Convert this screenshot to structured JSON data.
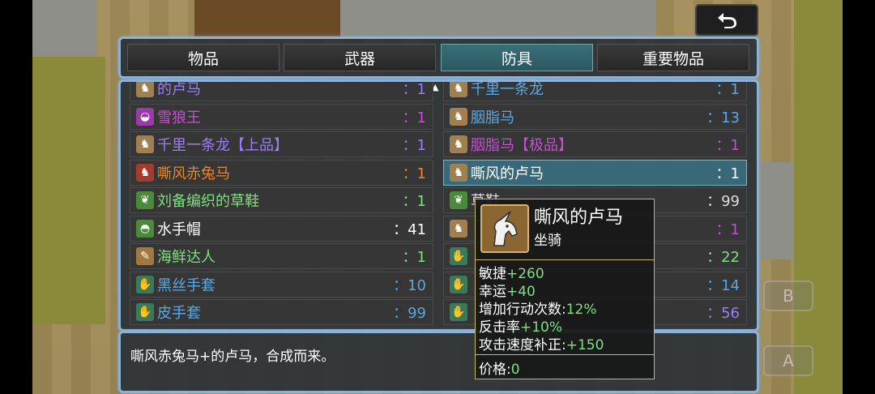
{
  "tabs": [
    "物品",
    "武器",
    "防具",
    "重要物品"
  ],
  "left_items": [
    {
      "name": "的卢马",
      "qty": "：1",
      "color": "#9c7df0",
      "icon": "horse-icon"
    },
    {
      "name": "雪狼王",
      "qty": "：1",
      "color": "#c24fd0",
      "icon": "wolf-icon"
    },
    {
      "name": "千里一条龙【上品】",
      "qty": "：1",
      "color": "#9c7df0",
      "icon": "horse-icon"
    },
    {
      "name": "嘶风赤兔马",
      "qty": "：1",
      "color": "#e8862a",
      "icon": "red-horse-icon"
    },
    {
      "name": "刘备编织的草鞋",
      "qty": "：1",
      "color": "#7ee07e",
      "icon": "sandals-icon"
    },
    {
      "name": "水手帽",
      "qty": "：41",
      "color": "#ffffff",
      "icon": "hat-icon"
    },
    {
      "name": "海鲜达人",
      "qty": "：1",
      "color": "#7ee07e",
      "icon": "fish-icon"
    },
    {
      "name": "黑丝手套",
      "qty": "：10",
      "color": "#5aa8e0",
      "icon": "glove-icon"
    },
    {
      "name": "皮手套",
      "qty": "：99",
      "color": "#5aa8e0",
      "icon": "glove-icon"
    }
  ],
  "right_items": [
    {
      "name": "千里一条龙",
      "qty": "：1",
      "color": "#5aa8e0",
      "icon": "horse-icon"
    },
    {
      "name": "胭脂马",
      "qty": "：13",
      "color": "#5aa8e0",
      "icon": "horse-icon"
    },
    {
      "name": "胭脂马【极品】",
      "qty": "：1",
      "color": "#c24fd0",
      "icon": "horse-icon"
    },
    {
      "name": "嘶风的卢马",
      "qty": "：1",
      "color": "#ffffff",
      "icon": "horse-icon"
    },
    {
      "name": "草鞋",
      "qty": "：99",
      "color": "#dddddd",
      "icon": "sandals-icon"
    },
    {
      "name": "",
      "qty": "：1",
      "color": "#c24fd0",
      "icon": "horse-icon"
    },
    {
      "name": "",
      "qty": "：22",
      "color": "#7ee07e",
      "icon": "glove-icon"
    },
    {
      "name": "",
      "qty": "：14",
      "color": "#5aa8e0",
      "icon": "glove-icon"
    },
    {
      "name": "",
      "qty": "：56",
      "color": "#9c7df0",
      "icon": "glove-icon"
    }
  ],
  "description": "嘶风赤兔马+的卢马，合成而来。",
  "tooltip": {
    "name": "嘶风的卢马",
    "type": "坐骑",
    "stats": [
      {
        "k": "敏捷",
        "v": "+260"
      },
      {
        "k": "幸运",
        "v": "+40"
      },
      {
        "k": "增加行动次数:",
        "v": "12%"
      },
      {
        "k": "反击率",
        "v": "+10%"
      },
      {
        "k": "攻击速度补正:",
        "v": "+150"
      }
    ],
    "price_label": "价格:",
    "price_value": "0"
  },
  "buttons": {
    "b": "B",
    "a": "A"
  }
}
